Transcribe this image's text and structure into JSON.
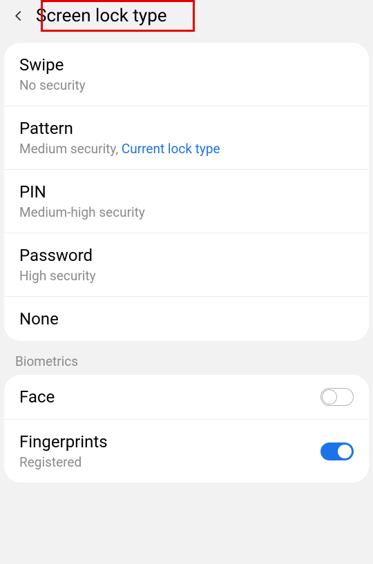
{
  "header": {
    "title": "Screen lock type"
  },
  "lockTypes": {
    "swipe": {
      "title": "Swipe",
      "subtitle": "No security"
    },
    "pattern": {
      "title": "Pattern",
      "subtitlePrefix": "Medium security, ",
      "currentLabel": "Current lock type"
    },
    "pin": {
      "title": "PIN",
      "subtitle": "Medium-high security"
    },
    "password": {
      "title": "Password",
      "subtitle": "High security"
    },
    "none": {
      "title": "None"
    }
  },
  "biometrics": {
    "sectionLabel": "Biometrics",
    "face": {
      "title": "Face",
      "enabled": false
    },
    "fingerprints": {
      "title": "Fingerprints",
      "subtitle": "Registered",
      "enabled": true
    }
  }
}
